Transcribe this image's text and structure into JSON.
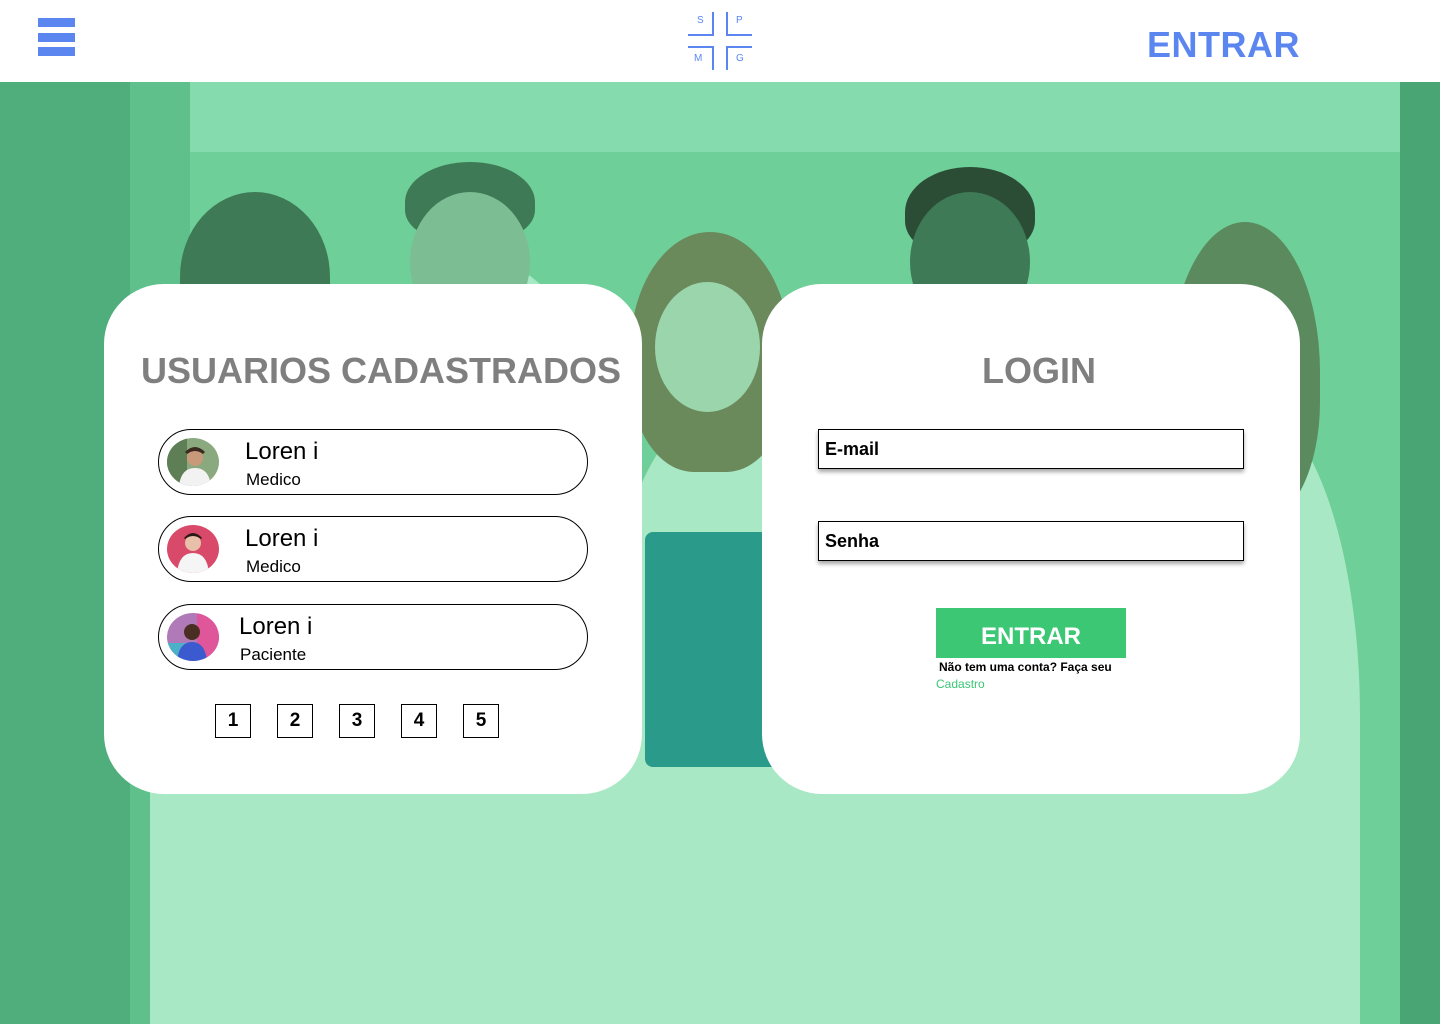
{
  "header": {
    "logo_letters": [
      "S",
      "P",
      "M",
      "G"
    ],
    "login_label": "ENTRAR"
  },
  "users_card": {
    "title": "USUARIOS CADASTRADOS",
    "users": [
      {
        "name": "Loren i",
        "role": "Medico"
      },
      {
        "name": "Loren i",
        "role": "Medico"
      },
      {
        "name": "Loren i",
        "role": "Paciente"
      }
    ],
    "pages": [
      "1",
      "2",
      "3",
      "4",
      "5"
    ]
  },
  "login_card": {
    "title": "LOGIN",
    "email_placeholder": "E-mail",
    "password_placeholder": "Senha",
    "submit_label": "ENTRAR",
    "signup_prompt": "Não tem uma conta? Faça seu",
    "signup_link": "Cadastro"
  },
  "colors": {
    "brand_blue": "#5b86f0",
    "accent_green": "#3cc775",
    "overlay_green": "#6fcf99"
  }
}
